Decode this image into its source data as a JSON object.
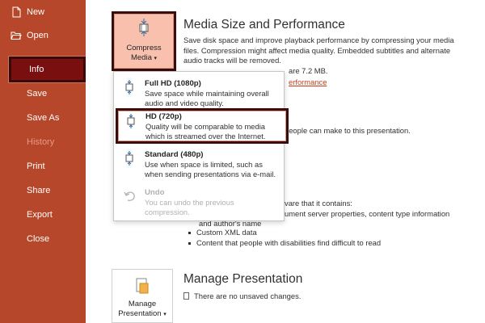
{
  "sidebar": {
    "items": [
      {
        "label": "New"
      },
      {
        "label": "Open"
      },
      {
        "label": "Info"
      },
      {
        "label": "Save"
      },
      {
        "label": "Save As"
      },
      {
        "label": "History"
      },
      {
        "label": "Print"
      },
      {
        "label": "Share"
      },
      {
        "label": "Export"
      },
      {
        "label": "Close"
      }
    ]
  },
  "media": {
    "title": "Media Size and Performance",
    "button_label_1": "Compress",
    "button_label_2": "Media",
    "desc_1": "Save disk space and improve playback performance by compressing your media",
    "desc_2": "files. Compression might affect media quality. Embedded subtitles and alternate",
    "desc_3": "audio tracks will be removed.",
    "size_text": "are 7.2 MB.",
    "link_text": "erformance"
  },
  "menu": {
    "items": [
      {
        "title": "Full HD (1080p)",
        "desc_1": "Save space while maintaining overall",
        "desc_2": "audio and video quality."
      },
      {
        "title": "HD (720p)",
        "desc_1": "Quality will be comparable to media",
        "desc_2": "which is streamed over the Internet."
      },
      {
        "title": "Standard (480p)",
        "desc_1": "Use when space is limited, such as",
        "desc_2": "when sending presentations via e-mail."
      },
      {
        "title": "Undo",
        "desc_1": "You can undo the previous",
        "desc_2": "compression."
      }
    ]
  },
  "protect": {
    "partial_1": "people can make to this presentation.",
    "partial_2": "vare that it contains:",
    "partial_3": "ument server properties, content type information",
    "partial_4": "and author's name"
  },
  "bullets": [
    "Custom XML data",
    "Content that people with disabilities find difficult to read"
  ],
  "manage": {
    "title": "Manage Presentation",
    "button_label_1": "Manage",
    "button_label_2": "Presentation",
    "status": "There are no unsaved changes."
  },
  "colors": {
    "sidebar": "#b7472a",
    "active": "#7a0f0f",
    "link": "#c43e1c"
  }
}
